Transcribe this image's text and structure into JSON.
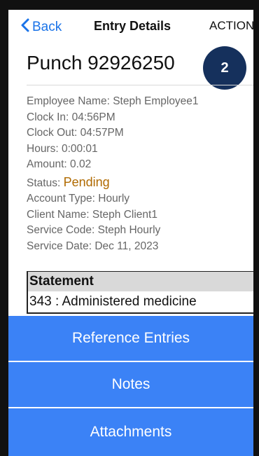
{
  "navbar": {
    "back_label": "Back",
    "title": "Entry Details",
    "action_label": "ACTION"
  },
  "entry": {
    "heading": "Punch 92926250",
    "badge_count": "2"
  },
  "details": {
    "employee": "Employee Name: Steph Employee1",
    "clock_in": "Clock In: 04:56PM",
    "clock_out": "Clock Out: 04:57PM",
    "hours": "Hours: 0:00:01",
    "amount": "Amount: 0.02",
    "status_label": "Status: ",
    "status_value": "Pending",
    "account_type": "Account Type: Hourly",
    "client_name": "Client Name: Steph Client1",
    "service_code": "Service Code: Steph Hourly",
    "service_date": "Service Date: Dec 11, 2023"
  },
  "statement": {
    "header": "Statement",
    "value": "343 : Administered medicine"
  },
  "buttons": {
    "reference_entries": "Reference Entries",
    "notes": "Notes",
    "attachments": "Attachments"
  },
  "colors": {
    "accent": "#3b82f6",
    "link": "#1a73e8",
    "badge": "#15305c",
    "status_pending": "#b06a00"
  }
}
